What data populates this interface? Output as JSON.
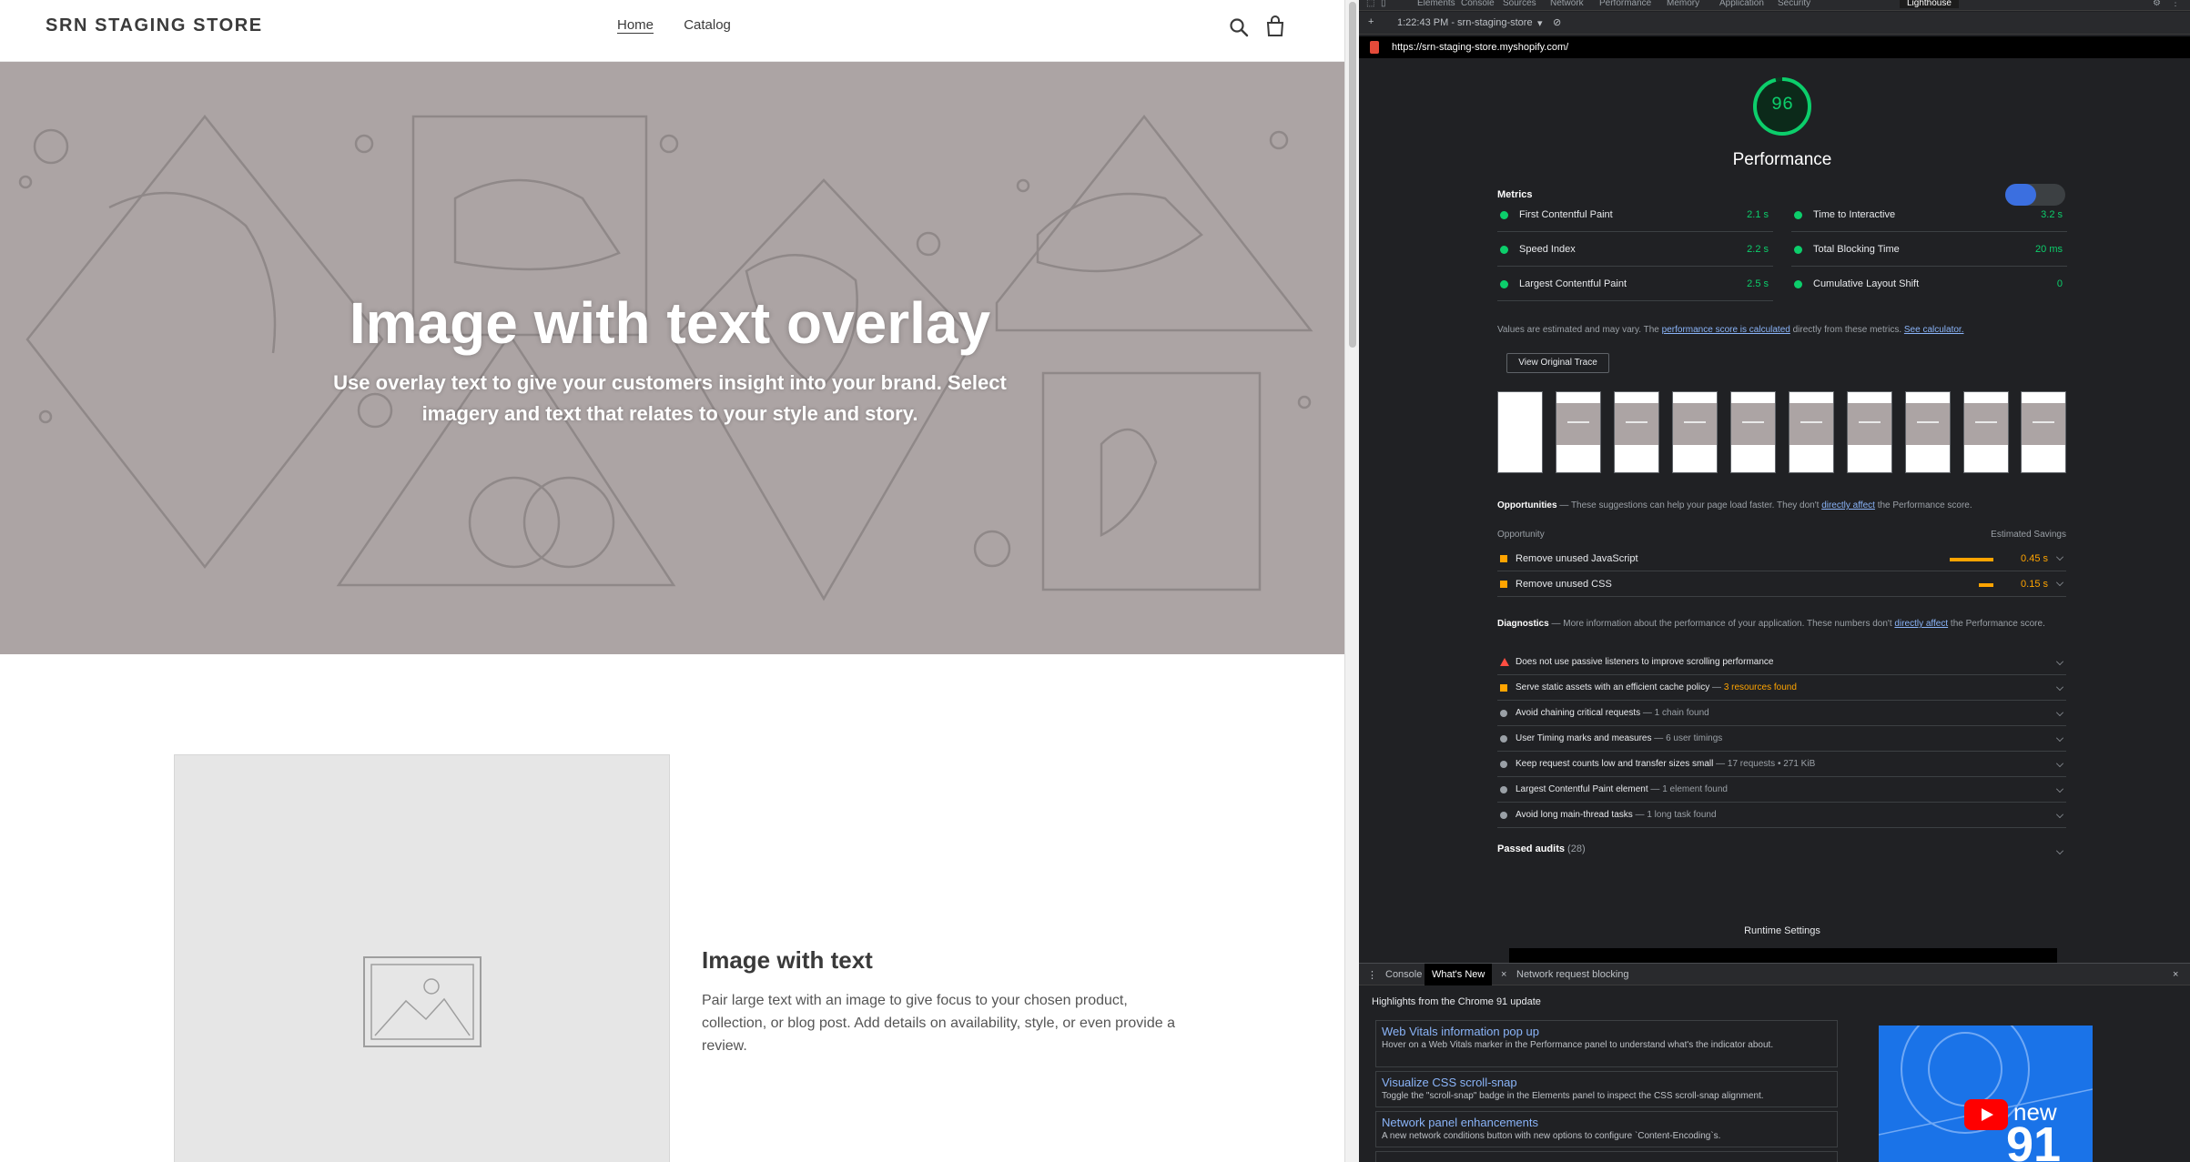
{
  "store": {
    "logo": "SRN STAGING STORE",
    "nav": [
      {
        "label": "Home",
        "active": true
      },
      {
        "label": "Catalog",
        "active": false
      }
    ],
    "search_icon": "search-icon",
    "cart_icon": "cart-icon",
    "hero": {
      "title": "Image with text overlay",
      "subtitle": "Use overlay text to give your customers insight into your brand. Select imagery and text that relates to your style and story.",
      "bg_color": "#aca4a4"
    },
    "feature": {
      "title": "Image with text",
      "text": "Pair large text with an image to give focus to your chosen product, collection, or blog post. Add details on availability, style, or even provide a review."
    }
  },
  "devtools": {
    "tabs": [
      "Elements",
      "Console",
      "Sources",
      "Network",
      "Performance",
      "Memory",
      "Application",
      "Security",
      "Lighthouse"
    ],
    "active_tab": "Lighthouse",
    "report_time": "1:22:43 PM - srn-staging-store",
    "url": "https://srn-staging-store.myshopify.com/",
    "lighthouse": {
      "score": "96",
      "score_color": "#0cce6b",
      "category": "Performance",
      "metrics_label": "Metrics",
      "metrics": [
        {
          "name": "First Contentful Paint",
          "value": "2.1 s"
        },
        {
          "name": "Time to Interactive",
          "value": "3.2 s"
        },
        {
          "name": "Speed Index",
          "value": "2.2 s"
        },
        {
          "name": "Total Blocking Time",
          "value": "20 ms"
        },
        {
          "name": "Largest Contentful Paint",
          "value": "2.5 s"
        },
        {
          "name": "Cumulative Layout Shift",
          "value": "0"
        }
      ],
      "note_prefix": "Values are estimated and may vary. The ",
      "note_link1": "performance score is calculated",
      "note_mid": " directly from these metrics. ",
      "note_link2": "See calculator.",
      "trace_button": "View Original Trace",
      "opportunities": {
        "title": "Opportunities",
        "desc_prefix": " — These suggestions can help your page load faster. They don't ",
        "desc_link": "directly affect",
        "desc_suffix": " the Performance score.",
        "col_left": "Opportunity",
        "col_right": "Estimated Savings",
        "items": [
          {
            "name": "Remove unused JavaScript",
            "value": "0.45 s",
            "fraction": 1.0
          },
          {
            "name": "Remove unused CSS",
            "value": "0.15 s",
            "fraction": 0.33
          }
        ]
      },
      "diagnostics": {
        "title": "Diagnostics",
        "desc_prefix": " — More information about the performance of your application. These numbers don't ",
        "desc_link": "directly affect",
        "desc_suffix": " the Performance score.",
        "items": [
          {
            "name": "Does not use passive listeners to improve scrolling performance",
            "extra": "",
            "marker": "triangle"
          },
          {
            "name": "Serve static assets with an efficient cache policy",
            "extra": "3 resources found",
            "marker": "square"
          },
          {
            "name": "Avoid chaining critical requests",
            "extra": "1 chain found",
            "marker": "circle"
          },
          {
            "name": "User Timing marks and measures",
            "extra": "6 user timings",
            "marker": "circle"
          },
          {
            "name": "Keep request counts low and transfer sizes small",
            "extra": "17 requests • 271 KiB",
            "marker": "circle"
          },
          {
            "name": "Largest Contentful Paint element",
            "extra": "1 element found",
            "marker": "circle"
          },
          {
            "name": "Avoid long main-thread tasks",
            "extra": "1 long task found",
            "marker": "circle"
          }
        ]
      },
      "passed_label": "Passed audits",
      "passed_count": "(28)",
      "runtime_label": "Runtime Settings"
    },
    "drawer": {
      "tabs": [
        "Console",
        "What's New",
        "Network request blocking"
      ],
      "active_tab": "What's New",
      "headline": "Highlights from the Chrome 91 update",
      "news": [
        {
          "title": "Web Vitals information pop up",
          "desc": "Hover on a Web Vitals marker in the Performance panel to understand what's the indicator about."
        },
        {
          "title": "Visualize CSS scroll-snap",
          "desc": "Toggle the \"scroll-snap\" badge in the Elements panel to inspect the CSS scroll-snap alignment."
        },
        {
          "title": "Network panel enhancements",
          "desc": "A new network conditions button with new options to configure `Content-Encoding`s."
        }
      ],
      "video_word": "new",
      "video_number": "91"
    }
  }
}
